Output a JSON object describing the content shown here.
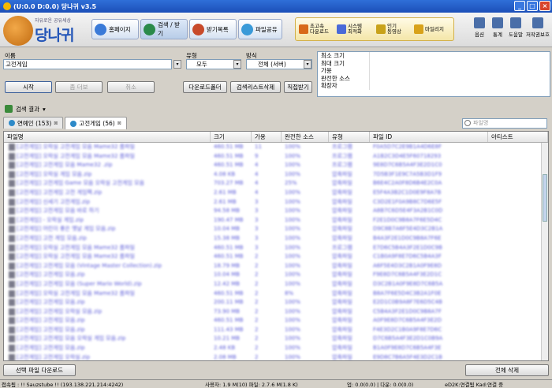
{
  "window": {
    "title": "(U:0.0 D:0.0) 당나귀 v3.5",
    "min": "_",
    "max": "□",
    "close": "×"
  },
  "logo": {
    "tagline": "자유로운 공유세상",
    "name": "당나귀"
  },
  "nav": [
    {
      "label": "홈페이지",
      "color": "#3a7ad8"
    },
    {
      "label": "검색 / 받기",
      "color": "#2a8a4a"
    },
    {
      "label": "받기목록",
      "color": "#c84a2a"
    },
    {
      "label": "파일공유",
      "color": "#3a9ad8"
    }
  ],
  "tools": [
    {
      "label": "초고속\n다운로드",
      "color": "#d86a1a"
    },
    {
      "label": "시스템\n최적화",
      "color": "#4a6ad8"
    },
    {
      "label": "인기\n동영상",
      "color": "#c8a21a"
    },
    {
      "label": "마일리지",
      "color": "#d8a21a"
    }
  ],
  "right_tools": [
    {
      "label": "옵션"
    },
    {
      "label": "통계"
    },
    {
      "label": "도움말"
    },
    {
      "label": "저작권보호"
    }
  ],
  "search": {
    "name_label": "이름",
    "name_value": "고전게임",
    "type_label": "유형",
    "type_value": "모두",
    "method_label": "방식",
    "method_value": "전체 (서버)",
    "start_btn": "시작",
    "more_btn": "좀 더보",
    "cancel_btn": "취소",
    "download_folder_btn": "다운로드폴더",
    "delete_list_btn": "검색리스트삭제",
    "direct_btn": "직접받기"
  },
  "info": [
    {
      "key": "최소 크기",
      "value": ""
    },
    {
      "key": "최대 크기",
      "value": ""
    },
    {
      "key": "가용",
      "value": ""
    },
    {
      "key": "완전한 소스",
      "value": ""
    },
    {
      "key": "확장자",
      "value": ""
    }
  ],
  "results_section": "검색 결과",
  "tabs": [
    {
      "label": "연예인 (153)",
      "active": false
    },
    {
      "label": "고전게임 (56)",
      "active": true
    }
  ],
  "filter_placeholder": "파일명",
  "columns": [
    "파일명",
    "크기",
    "가용",
    "완전한 소스",
    "유형",
    "파일 ID",
    "아티스트"
  ],
  "rows": [
    [
      "[고전게임] 오락실 고전게임 모음 Mame32 롬파일",
      "460.51 MB",
      "11",
      "100%",
      "프로그램",
      "F0A5D7C2E9B1A4D6E8F",
      ""
    ],
    [
      "[고전게임] 오락실 고전게임 모음 Mame32 롬파일",
      "460.51 MB",
      "9",
      "100%",
      "프로그램",
      "A1B2C3D4E5F60718293",
      ""
    ],
    [
      "[고전게임] 고전게임 모음 Mame32 .zip",
      "460.51 MB",
      "4",
      "100%",
      "프로그램",
      "9E8D7C6B5A4F3E2D1C0",
      ""
    ],
    [
      "[고전게임] 오락실 게임 모음.zip",
      "4.08 KB",
      "4",
      "100%",
      "압축파일",
      "7D5B3F1E9C7A5B3D1F9",
      ""
    ],
    [
      "[고전게임] 고전게임 Game 모음 오락실 고전게임 모음",
      "703.27 MB",
      "4",
      "25%",
      "압축파일",
      "B6E4C2A0F8D6B4E2C0A",
      ""
    ],
    [
      "[고전게임] 고전게임 고전 게임팩.zip",
      "2.61 MB",
      "4",
      "100%",
      "압축파일",
      "E5F4A3B2C1D0E9F8A7B",
      ""
    ],
    [
      "[고전게임] 신세기 고전게임.zip",
      "2.61 MB",
      "3",
      "100%",
      "압축파일",
      "C3D2E1F0A9B8C7D6E5F",
      ""
    ],
    [
      "[고전게임] 고전게임 모음 바로 하기",
      "94.58 MB",
      "3",
      "100%",
      "압축파일",
      "A8B7C6D5E4F3A2B1C0D",
      ""
    ],
    [
      "[고전게임] - 오락실 게임.zip",
      "190.47 MB",
      "3",
      "100%",
      "압축파일",
      "F2E1D0C9B8A7F6E5D4C",
      ""
    ],
    [
      "[고전게임] 어린이 좋은 옛날 게임 모음.zip",
      "10.04 MB",
      "3",
      "100%",
      "압축파일",
      "D9C8B7A6F5E4D3C2B1A",
      ""
    ],
    [
      "[고전게임] 고전 게임 모음.zip",
      "15.38 MB",
      "3",
      "100%",
      "압축파일",
      "B4A3F2E1D0C9B8A7F6E",
      ""
    ],
    [
      "[고전게임] 오락실 고전게임 모음 Mame32 롬파일",
      "460.51 MB",
      "3",
      "100%",
      "프로그램",
      "E7D6C5B4A3F2E1D0C9B",
      ""
    ],
    [
      "[고전게임] 오락실 고전게임 모음 Mame32 롬파일",
      "460.51 MB",
      "2",
      "100%",
      "압축파일",
      "C1B0A9F8E7D6C5B4A3F",
      ""
    ],
    [
      "[고전게임] 고전게임 모음 (Vintage Master Collection).zip",
      "18.79 MB",
      "2",
      "100%",
      "압축파일",
      "A6F5E4D3C2B1A0F9E8D",
      ""
    ],
    [
      "[고전게임] 고전게임 모음.zip",
      "10.04 MB",
      "2",
      "100%",
      "압축파일",
      "F9E8D7C6B5A4F3E2D1C",
      ""
    ],
    [
      "[고전게임] 고전게임 모음 (Super Mario World).zip",
      "12.42 MB",
      "2",
      "100%",
      "압축파일",
      "D3C2B1A0F9E8D7C6B5A",
      ""
    ],
    [
      "[고전게임] 오락실 고전게임 모음 Mame32 롬파일",
      "460.51 MB",
      "2",
      "8%",
      "압축파일",
      "B8A7F6E5D4C3B2A1F0E",
      ""
    ],
    [
      "[고전게임] 고전게임 모음.zip",
      "200.11 MB",
      "2",
      "100%",
      "압축파일",
      "E2D1C0B9A8F7E6D5C4B",
      ""
    ],
    [
      "[고전게임] 고전게임 오락실 모음.zip",
      "73.90 MB",
      "2",
      "100%",
      "압축파일",
      "C5B4A3F2E1D0C9B8A7F",
      ""
    ],
    [
      "[고전게임] 고전게임 모음.zip",
      "460.51 MB",
      "2",
      "100%",
      "압축파일",
      "A0F9E8D7C6B5A4F3E2D",
      ""
    ],
    [
      "[고전게임] 고전게임 모음.zip",
      "111.43 MB",
      "2",
      "100%",
      "압축파일",
      "F4E3D2C1B0A9F8E7D6C",
      ""
    ],
    [
      "[고전게임] 고전게임 모음 오락실 게임 모음.zip",
      "10.21 MB",
      "2",
      "100%",
      "압축파일",
      "D7C6B5A4F3E2D1C0B9A",
      ""
    ],
    [
      "[고전게임] 고전게임 모음.zip",
      "2.48 KB",
      "2",
      "100%",
      "압축파일",
      "B1A0F9E8D7C6B5A4F3E",
      ""
    ],
    [
      "[고전게임] 고전게임 오락실.zip",
      "2.08 MB",
      "2",
      "100%",
      "압축파일",
      "E9D8C7B6A5F4E3D2C1B",
      ""
    ],
    [
      "[고전게임] 고전게임 모음.zip",
      "15.38 MB",
      "2",
      "100%",
      "압축파일",
      "C0B9A8F7E6D5C4B3A2F",
      ""
    ]
  ],
  "bottom": {
    "download_btn": "선택 파일 다운로드",
    "delete_all_btn": "전체 삭제"
  },
  "status": {
    "server": "접속됨 : !! Sauzstube !! (193.138.221.214:4242)",
    "users": "사용자: 1.9 M(10) 파일: 2.7.6 M(1.8 K)",
    "speed": "업: 0.0(0.0) | 다운: 0.0(0.0)",
    "conn": "eD2K:연결됨 Kad:연결 중"
  }
}
